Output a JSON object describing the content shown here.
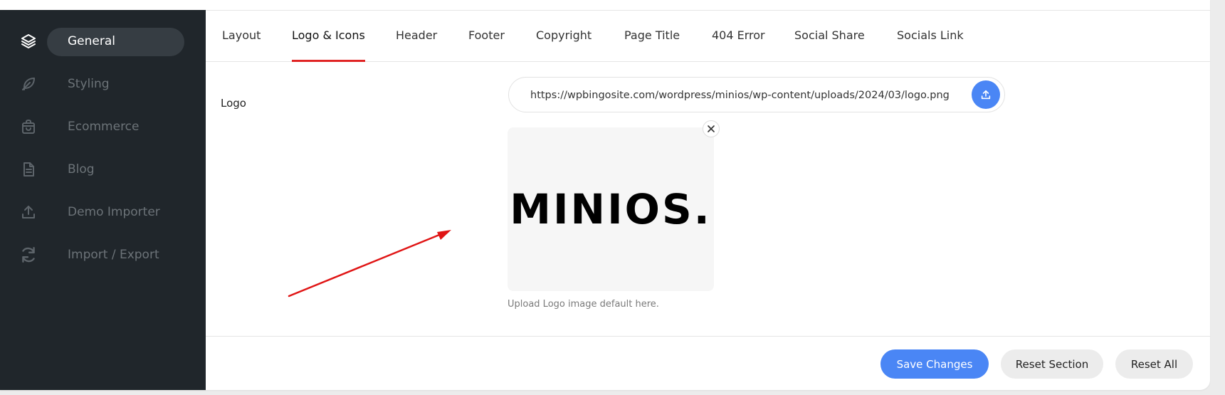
{
  "sidebar": {
    "items": [
      {
        "label": "General",
        "icon": "layers-icon",
        "active": true
      },
      {
        "label": "Styling",
        "icon": "feather-icon",
        "active": false
      },
      {
        "label": "Ecommerce",
        "icon": "shopping-bag-icon",
        "active": false
      },
      {
        "label": "Blog",
        "icon": "document-icon",
        "active": false
      },
      {
        "label": "Demo Importer",
        "icon": "upload-icon",
        "active": false
      },
      {
        "label": "Import / Export",
        "icon": "refresh-icon",
        "active": false
      }
    ]
  },
  "tabs": [
    {
      "label": "Layout",
      "active": false
    },
    {
      "label": "Logo & Icons",
      "active": true
    },
    {
      "label": "Header",
      "active": false
    },
    {
      "label": "Footer",
      "active": false
    },
    {
      "label": "Copyright",
      "active": false
    },
    {
      "label": "Page Title",
      "active": false
    },
    {
      "label": "404 Error",
      "active": false
    },
    {
      "label": "Social Share",
      "active": false
    },
    {
      "label": "Socials Link",
      "active": false
    }
  ],
  "logo_field": {
    "label": "Logo",
    "url": "https://wpbingosite.com/wordpress/minios/wp-content/uploads/2024/03/logo.png",
    "preview_text": "MINIOS.",
    "help": "Upload Logo image default here."
  },
  "actions": {
    "save": "Save Changes",
    "reset_section": "Reset Section",
    "reset_all": "Reset All"
  },
  "colors": {
    "sidebar_bg": "#20262b",
    "accent_blue": "#4a86f5",
    "tab_underline": "#e02424",
    "annotation_arrow": "#e01515"
  }
}
